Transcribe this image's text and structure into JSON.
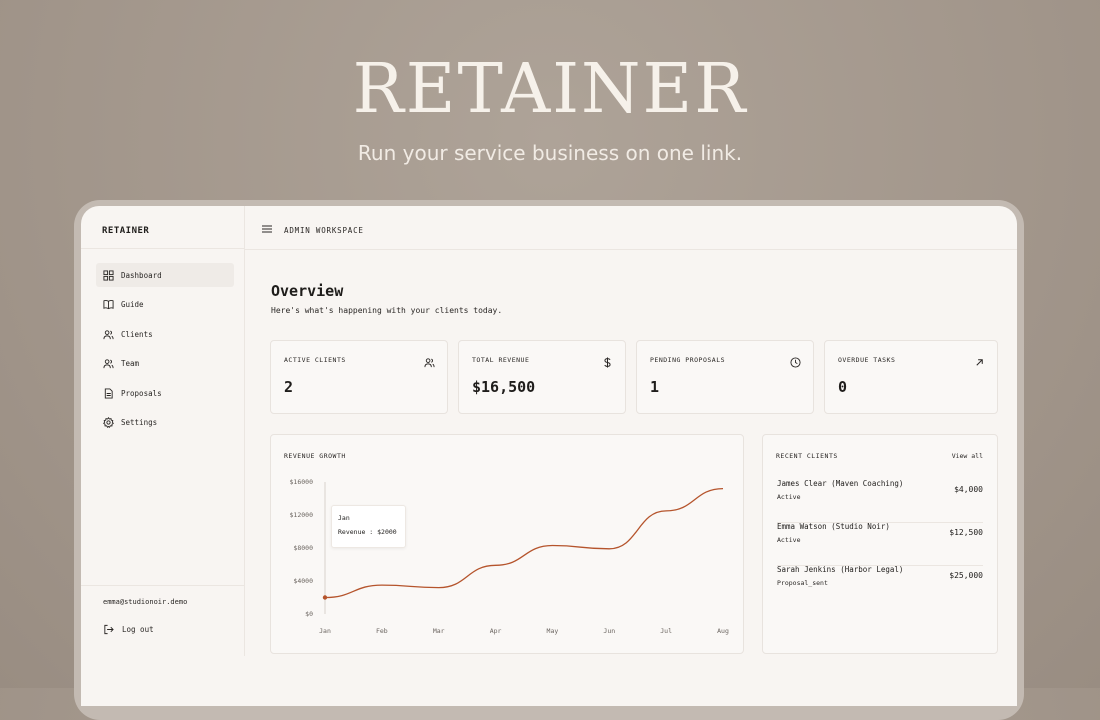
{
  "hero": {
    "title": "RETAINER",
    "subtitle": "Run your service business on one link."
  },
  "sidebar": {
    "brand": "RETAINER",
    "items": [
      {
        "label": "Dashboard",
        "icon": "dashboard-icon",
        "active": true
      },
      {
        "label": "Guide",
        "icon": "book-icon",
        "active": false
      },
      {
        "label": "Clients",
        "icon": "users-icon",
        "active": false
      },
      {
        "label": "Team",
        "icon": "users-icon",
        "active": false
      },
      {
        "label": "Proposals",
        "icon": "file-icon",
        "active": false
      },
      {
        "label": "Settings",
        "icon": "gear-icon",
        "active": false
      }
    ],
    "user_email": "emma@studionoir.demo",
    "logout_label": "Log out"
  },
  "topbar": {
    "workspace_label": "ADMIN WORKSPACE"
  },
  "main": {
    "title": "Overview",
    "subtitle": "Here's what's happening with your clients today."
  },
  "stats": [
    {
      "label": "ACTIVE CLIENTS",
      "value": "2",
      "icon": "users-icon"
    },
    {
      "label": "TOTAL REVENUE",
      "value": "$16,500",
      "icon": "dollar-icon"
    },
    {
      "label": "PENDING PROPOSALS",
      "value": "1",
      "icon": "clock-icon"
    },
    {
      "label": "OVERDUE TASKS",
      "value": "0",
      "icon": "arrow-up-right-icon"
    }
  ],
  "revenue_panel": {
    "title": "REVENUE GROWTH",
    "tooltip_label": "Jan",
    "tooltip_value": "Revenue : $2000"
  },
  "chart_data": {
    "type": "line",
    "title": "REVENUE GROWTH",
    "categories": [
      "Jan",
      "Feb",
      "Mar",
      "Apr",
      "May",
      "Jun",
      "Jul",
      "Aug"
    ],
    "series": [
      {
        "values": [
          2000,
          3500,
          3200,
          5900,
          8300,
          7900,
          12500,
          15200
        ]
      }
    ],
    "yticks": [
      "$0",
      "$4000",
      "$8000",
      "$12000",
      "$16000"
    ],
    "ylim": [
      0,
      16000
    ],
    "grid": false,
    "line_color": "#b5542c"
  },
  "recent_clients": {
    "title": "RECENT CLIENTS",
    "view_all_label": "View all",
    "rows": [
      {
        "name": "James Clear (Maven Coaching)",
        "status": "Active",
        "amount": "$4,000"
      },
      {
        "name": "Emma Watson (Studio Noir)",
        "status": "Active",
        "amount": "$12,500"
      },
      {
        "name": "Sarah Jenkins (Harbor Legal)",
        "status": "Proposal_sent",
        "amount": "$25,000"
      }
    ]
  }
}
